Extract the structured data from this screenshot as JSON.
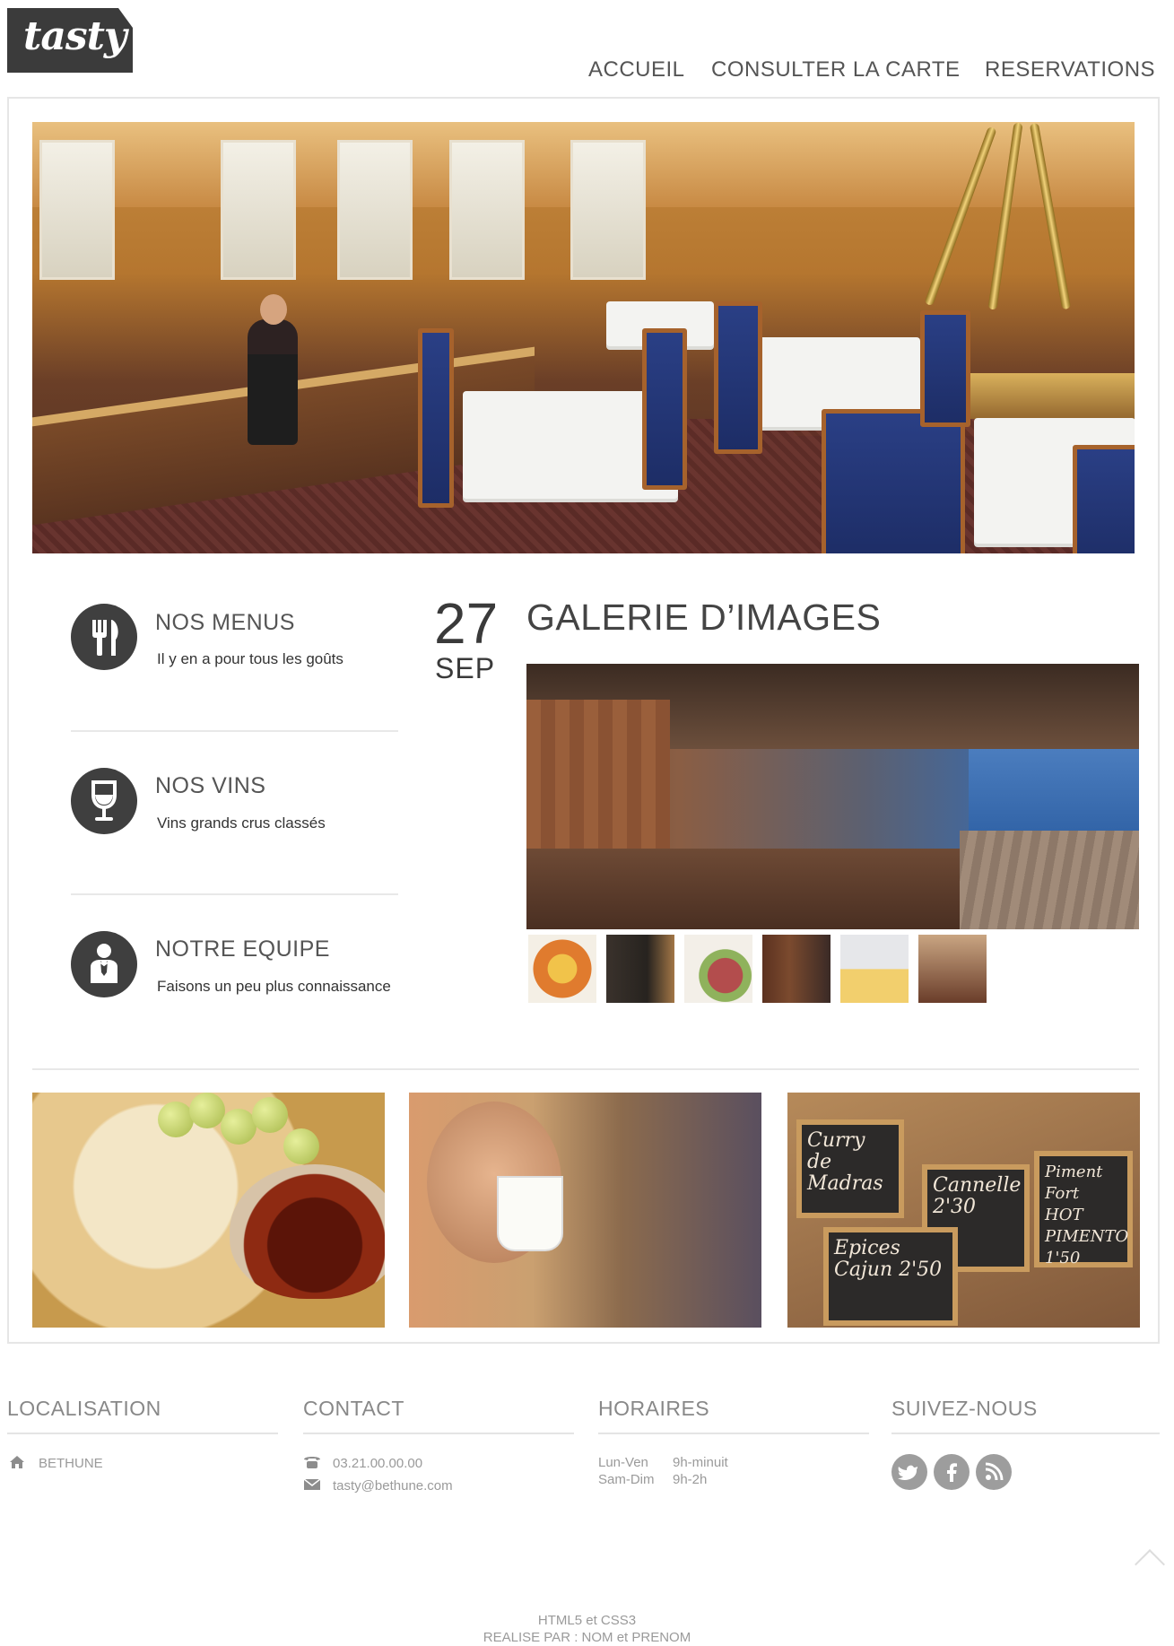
{
  "header": {
    "logo_text": "tasty",
    "nav": [
      "ACCUEIL",
      "CONSULTER LA CARTE",
      "RESERVATIONS"
    ]
  },
  "features": [
    {
      "title": "NOS MENUS",
      "desc": "Il y en a pour tous les goûts",
      "icon": "cutlery-icon"
    },
    {
      "title": "NOS VINS",
      "desc": "Vins  grands crus classés",
      "icon": "wine-glass-icon"
    },
    {
      "title": "NOTRE EQUIPE",
      "desc": "Faisons un peu plus connaissance",
      "icon": "waiter-icon"
    }
  ],
  "date": {
    "day": "27",
    "month": "SEP"
  },
  "gallery": {
    "title": "GALERIE D’IMAGES",
    "thumb_count": 6
  },
  "boards": [
    "Curry de Madras",
    "Cannelle 2'30",
    "Piment Fort HOT PIMENTO 1'50",
    "Epices Cajun 2'50"
  ],
  "footer": {
    "localisation": {
      "heading": "LOCALISATION",
      "city": "BETHUNE"
    },
    "contact": {
      "heading": "CONTACT",
      "phone": "03.21.00.00.00",
      "email": "tasty@bethune.com"
    },
    "horaires": {
      "heading": "HORAIRES",
      "rows": [
        {
          "days": "Lun-Ven",
          "hours": "9h-minuit"
        },
        {
          "days": "Sam-Dim",
          "hours": "9h-2h"
        }
      ]
    },
    "social": {
      "heading": "SUIVEZ-NOUS",
      "icons": [
        "twitter-icon",
        "facebook-icon",
        "rss-icon"
      ]
    },
    "credits": [
      "HTML5 et CSS3",
      "REALISE PAR : NOM et PRENOM"
    ]
  },
  "colors": {
    "icon_bg": "#3f3f3f",
    "logo_bg": "#3b3b3b",
    "footer_text": "#9a9a9a"
  }
}
